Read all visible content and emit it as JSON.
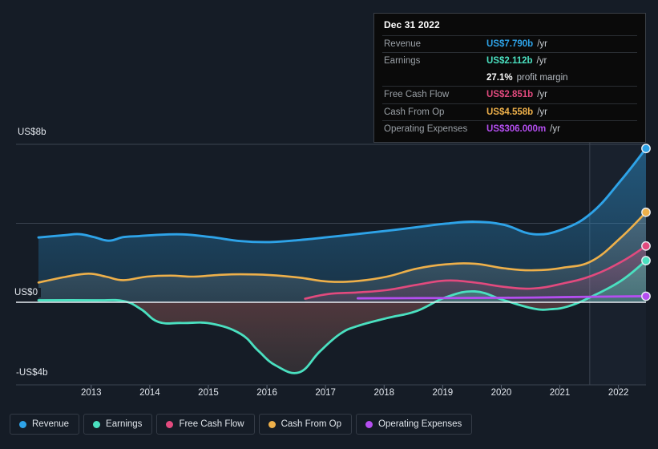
{
  "background_color": "#151c26",
  "tooltip": {
    "date": "Dec 31 2022",
    "rows": [
      {
        "label": "Revenue",
        "value": "US$7.790b",
        "unit": "/yr",
        "color": "#2ea3e8"
      },
      {
        "label": "Earnings",
        "value": "US$2.112b",
        "unit": "/yr",
        "color": "#4ae0c0"
      },
      {
        "label": "",
        "value": "27.1%",
        "unit": "profit margin",
        "color": "#ffffff",
        "sub": true
      },
      {
        "label": "Free Cash Flow",
        "value": "US$2.851b",
        "unit": "/yr",
        "color": "#e24a7e"
      },
      {
        "label": "Cash From Op",
        "value": "US$4.558b",
        "unit": "/yr",
        "color": "#eeb04a"
      },
      {
        "label": "Operating Expenses",
        "value": "US$306.000m",
        "unit": "/yr",
        "color": "#b44ef0"
      }
    ]
  },
  "legend": {
    "items": [
      {
        "label": "Revenue",
        "color": "#2ea3e8"
      },
      {
        "label": "Earnings",
        "color": "#4ae0c0"
      },
      {
        "label": "Free Cash Flow",
        "color": "#e24a7e"
      },
      {
        "label": "Cash From Op",
        "color": "#eeb04a"
      },
      {
        "label": "Operating Expenses",
        "color": "#b44ef0"
      }
    ]
  },
  "chart_data": {
    "type": "area",
    "title": "",
    "xlabel": "",
    "ylabel": "",
    "x": [
      2013,
      2014,
      2015,
      2016,
      2017,
      2018,
      2019,
      2020,
      2021,
      2022
    ],
    "xtick_labels": [
      "2013",
      "2014",
      "2015",
      "2016",
      "2017",
      "2018",
      "2019",
      "2020",
      "2021",
      "2022"
    ],
    "ytick_labels": [
      "US$8b",
      "US$0",
      "-US$4b"
    ],
    "ylim": [
      -4,
      8
    ],
    "gridlines": [
      8,
      4,
      0
    ],
    "zero_line": 0,
    "grid": true,
    "legend_position": "bottom",
    "currency": "USD",
    "units": "billions",
    "series": [
      {
        "name": "Revenue",
        "color": "#2ea3e8",
        "x": [
          2012.55,
          2013.0,
          2013.25,
          2013.5,
          2013.75,
          2014.0,
          2014.25,
          2014.5,
          2015.0,
          2015.5,
          2016.0,
          2016.5,
          2017.0,
          2017.5,
          2018.0,
          2018.5,
          2019.0,
          2019.5,
          2020.0,
          2020.5,
          2021.0,
          2021.5,
          2022.0,
          2022.5,
          2022.92
        ],
        "values": [
          3.28,
          3.4,
          3.45,
          3.3,
          3.12,
          3.3,
          3.35,
          3.4,
          3.44,
          3.3,
          3.1,
          3.05,
          3.15,
          3.3,
          3.46,
          3.62,
          3.8,
          3.98,
          4.08,
          3.92,
          3.45,
          3.7,
          4.55,
          6.2,
          7.79
        ]
      },
      {
        "name": "Earnings",
        "color": "#4ae0c0",
        "x": [
          2012.55,
          2013.5,
          2014.0,
          2014.3,
          2014.6,
          2015.0,
          2015.5,
          2016.0,
          2016.3,
          2016.6,
          2017.0,
          2017.35,
          2017.7,
          2018.0,
          2018.5,
          2019.0,
          2019.5,
          2020.0,
          2020.5,
          2021.0,
          2021.3,
          2021.6,
          2022.0,
          2022.5,
          2022.92
        ],
        "values": [
          0.1,
          0.1,
          0.06,
          -0.35,
          -1.0,
          -1.05,
          -1.08,
          -1.6,
          -2.45,
          -3.2,
          -3.55,
          -2.5,
          -1.6,
          -1.2,
          -0.8,
          -0.45,
          0.25,
          0.55,
          0.1,
          -0.32,
          -0.35,
          -0.2,
          0.3,
          1.1,
          2.11
        ]
      },
      {
        "name": "Free Cash Flow",
        "color": "#e24a7e",
        "x": [
          2017.1,
          2017.5,
          2018.0,
          2018.5,
          2019.0,
          2019.5,
          2020.0,
          2020.5,
          2021.0,
          2021.5,
          2022.0,
          2022.5,
          2022.92
        ],
        "values": [
          0.18,
          0.42,
          0.5,
          0.62,
          0.88,
          1.1,
          1.0,
          0.78,
          0.7,
          0.95,
          1.35,
          2.05,
          2.851
        ]
      },
      {
        "name": "Cash From Op",
        "color": "#eeb04a",
        "x": [
          2012.55,
          2013.0,
          2013.4,
          2013.7,
          2014.0,
          2014.4,
          2014.8,
          2015.2,
          2015.6,
          2016.0,
          2016.5,
          2017.0,
          2017.5,
          2018.0,
          2018.5,
          2019.0,
          2019.5,
          2020.0,
          2020.5,
          2021.0,
          2021.5,
          2022.0,
          2022.5,
          2022.92
        ],
        "values": [
          1.0,
          1.28,
          1.45,
          1.3,
          1.12,
          1.3,
          1.35,
          1.3,
          1.38,
          1.42,
          1.38,
          1.25,
          1.05,
          1.08,
          1.3,
          1.7,
          1.92,
          1.95,
          1.72,
          1.62,
          1.75,
          2.1,
          3.3,
          4.558
        ]
      },
      {
        "name": "Operating Expenses",
        "color": "#b44ef0",
        "x": [
          2018.0,
          2019.0,
          2020.0,
          2021.0,
          2022.0,
          2022.92
        ],
        "values": [
          0.2,
          0.21,
          0.22,
          0.24,
          0.28,
          0.306
        ]
      }
    ]
  }
}
